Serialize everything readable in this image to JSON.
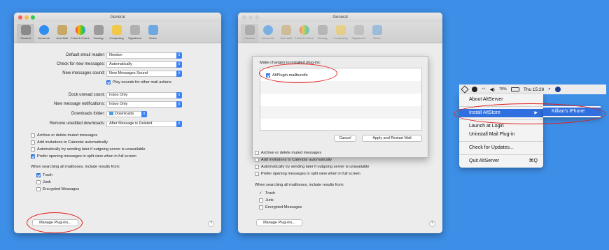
{
  "window1": {
    "title": "General",
    "toolbar": [
      "General",
      "Accounts",
      "Junk Mail",
      "Fonts & Colors",
      "Viewing",
      "Composing",
      "Signatures",
      "Rules"
    ],
    "default_reader": {
      "label": "Default email reader:",
      "value": "Newton"
    },
    "check_messages": {
      "label": "Check for new messages:",
      "value": "Automatically"
    },
    "new_sound": {
      "label": "New messages sound:",
      "value": "New Messages Sound"
    },
    "play_sounds": "Play sounds for other mail actions",
    "dock_count": {
      "label": "Dock unread count:",
      "value": "Inbox Only"
    },
    "notifications": {
      "label": "New message notifications:",
      "value": "Inbox Only"
    },
    "downloads": {
      "label": "Downloads folder:",
      "value": "Downloads"
    },
    "remove_downloads": {
      "label": "Remove unedited downloads:",
      "value": "After Message is Deleted"
    },
    "options": [
      "Archive or delete muted messages",
      "Add invitations to Calendar automatically",
      "Automatically try sending later if outgoing server is unavailable",
      "Prefer opening messages in split view when in full screen"
    ],
    "search_label": "When searching all mailboxes, include results from:",
    "search_opts": [
      "Trash",
      "Junk",
      "Encrypted Messages"
    ],
    "manage_btn": "Manage Plug-ins...",
    "help": "?"
  },
  "window2": {
    "title": "General",
    "sheet_title": "Make changes to installed plug-ins:",
    "plugin": "AltPlugin.mailbundle",
    "cancel": "Cancel",
    "apply": "Apply and Restart Mail",
    "options": [
      "Archive or delete muted messages",
      "Add invitations to Calendar automatically",
      "Automatically try sending later if outgoing server is unavailable",
      "Prefer opening messages in split view when in full screen"
    ],
    "search_label": "When searching all mailboxes, include results from:",
    "check_mark": "✓",
    "search_opts": [
      "Trash",
      "Junk",
      "Encrypted Messages"
    ],
    "manage_btn": "Manage Plug-ins...",
    "help": "?"
  },
  "menubar": {
    "battery": "79%",
    "time": "Thu 15:28"
  },
  "menu": {
    "items": [
      "About AltServer",
      "Install AltStore",
      "Launch at Login",
      "Uninstall Mail Plug-in",
      "Check for Updates...",
      "Quit AltServer"
    ],
    "quit_shortcut": "⌘Q",
    "submenu_arrow": "▶",
    "submenu_item": "Killian's iPhone"
  }
}
